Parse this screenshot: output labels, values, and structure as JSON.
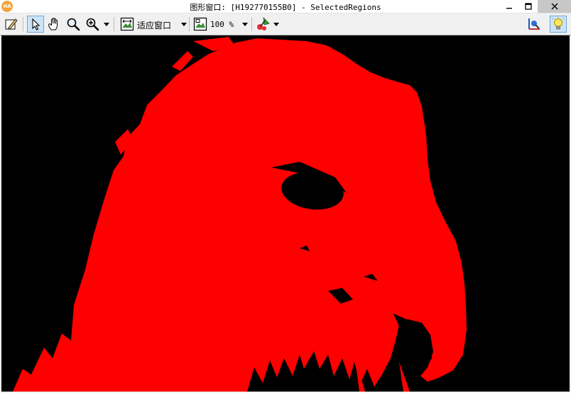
{
  "window": {
    "app_icon_text": "HA",
    "title": "图形窗口: [H192770155B0] - SelectedRegions",
    "controls": [
      "minimize-icon",
      "maximize-icon",
      "close-icon"
    ]
  },
  "toolbar": {
    "tools": [
      {
        "name": "edit-icon",
        "active": false
      },
      {
        "name": "pointer-icon",
        "active": true
      },
      {
        "name": "hand-pan-icon",
        "active": false
      },
      {
        "name": "magnifier-icon",
        "active": false
      },
      {
        "name": "zoom-in-icon",
        "active": false
      }
    ],
    "fit_mode_label": "适应窗口",
    "zoom_label": "100 %",
    "right_tools": [
      "pixel-info-icon",
      "lightbulb-icon"
    ]
  },
  "canvas": {
    "background_color": "#000000",
    "region_color": "#ff0000",
    "content": "segmented eagle head region"
  }
}
